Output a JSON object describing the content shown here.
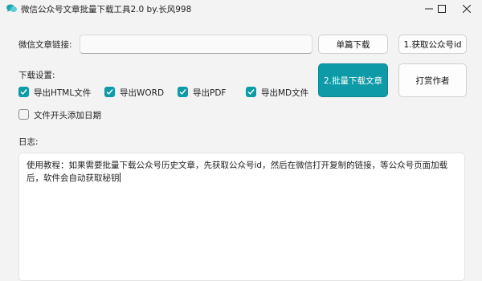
{
  "window": {
    "title": "微信公众号文章批量下载工具2.0 by.长风998",
    "icon": "chat-bubble-icon",
    "controls": [
      "minimize-icon",
      "maximize-icon",
      "close-icon"
    ]
  },
  "url_row": {
    "label": "微信文章链接:",
    "input_value": "",
    "single_download_label": "单篇下载",
    "get_id_label": "1.获取公众号id"
  },
  "download_settings": {
    "label": "下载设置:",
    "options": [
      {
        "label": "导出HTML文件",
        "checked": true
      },
      {
        "label": "导出WORD",
        "checked": true
      },
      {
        "label": "导出PDF",
        "checked": true
      },
      {
        "label": "导出MD文件",
        "checked": true
      }
    ],
    "date_option": {
      "label": "文件开头添加日期",
      "checked": false
    }
  },
  "actions": {
    "batch_download_label": "2.批量下载文章",
    "tip_author_label": "打赏作者"
  },
  "log": {
    "label": "日志:",
    "content": "使用教程：如果需要批量下载公众号历史文章，先获取公众号id，然后在微信打开复制的链接，等公众号页面加载后，软件会自动获取秘钥"
  },
  "colors": {
    "accent": "#0e9aa7",
    "background": "#f3f3f3"
  }
}
